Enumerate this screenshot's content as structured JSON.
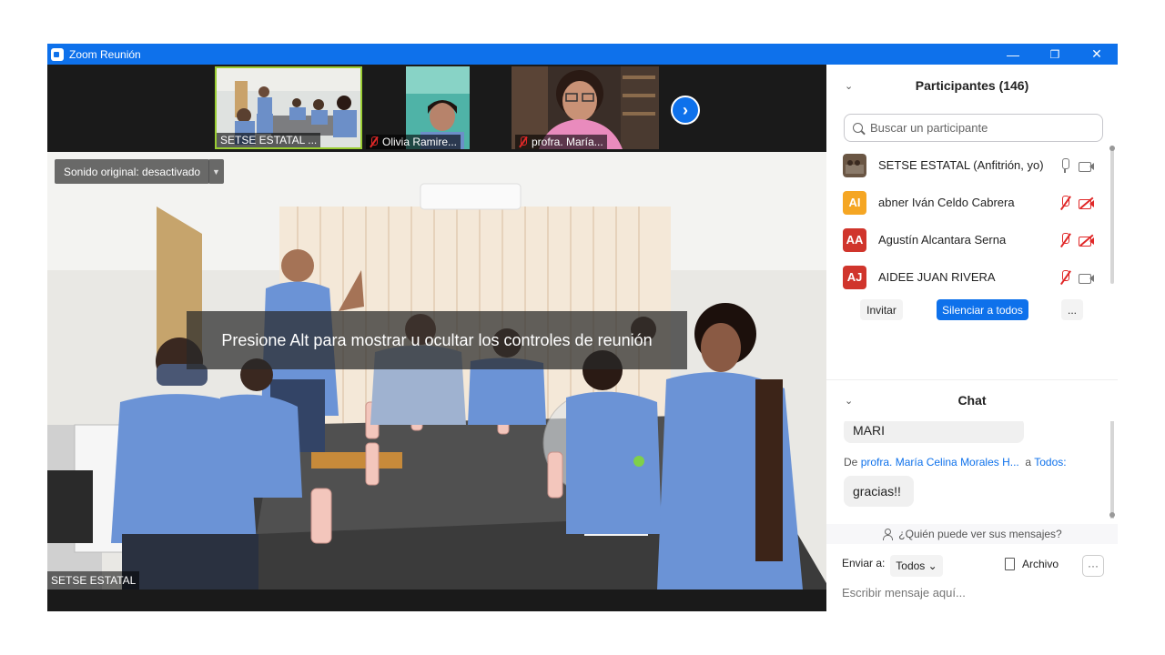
{
  "window": {
    "title": "Zoom Reunión",
    "controls": [
      "—",
      "❐",
      "✕"
    ]
  },
  "thumbnails": [
    {
      "name": "SETSE ESTATAL ...",
      "muted": false
    },
    {
      "name": "Olivia Ramire...",
      "muted": true
    },
    {
      "name": "profra. María...",
      "muted": true
    }
  ],
  "next_button": "›",
  "main_video": {
    "sound_label": "Sonido original: desactivado",
    "sound_arrow": "▼",
    "overlay": "Presione Alt para mostrar u ocultar los controles de reunión",
    "speaker_name": "SETSE ESTATAL"
  },
  "participants": {
    "header": "Participantes (146)",
    "collapse": "⌄",
    "search_placeholder": "Buscar un participante",
    "list": [
      {
        "initials": "",
        "name": "SETSE ESTATAL (Anfitrión, yo)",
        "color": "#5b4a3a",
        "mic_off": false,
        "cam_off": false
      },
      {
        "initials": "AI",
        "name": "abner Iván Celdo Cabrera",
        "color": "#f5a623",
        "mic_off": true,
        "cam_off": true
      },
      {
        "initials": "AA",
        "name": "Agustín Alcantara Serna",
        "color": "#d0352c",
        "mic_off": true,
        "cam_off": true
      },
      {
        "initials": "AJ",
        "name": "AIDEE JUAN RIVERA",
        "color": "#d0352c",
        "mic_off": true,
        "cam_off": false
      }
    ],
    "buttons": {
      "invite": "Invitar",
      "mute_all": "Silenciar a todos",
      "more": "..."
    }
  },
  "chat": {
    "header": "Chat",
    "collapse": "⌄",
    "messages": [
      {
        "text": "MARI"
      },
      {
        "from_prefix": "De",
        "from": "profra. María Celina Morales H...",
        "to_prefix": "a",
        "to": "Todos:",
        "text": "gracias!!"
      }
    ],
    "who_sees": "¿Quién puede ver sus mensajes?",
    "send_to_label": "Enviar a:",
    "send_to_value": "Todos",
    "send_to_arrow": "⌄",
    "file_label": "Archivo",
    "more": "···",
    "input_placeholder": "Escribir mensaje aquí..."
  }
}
